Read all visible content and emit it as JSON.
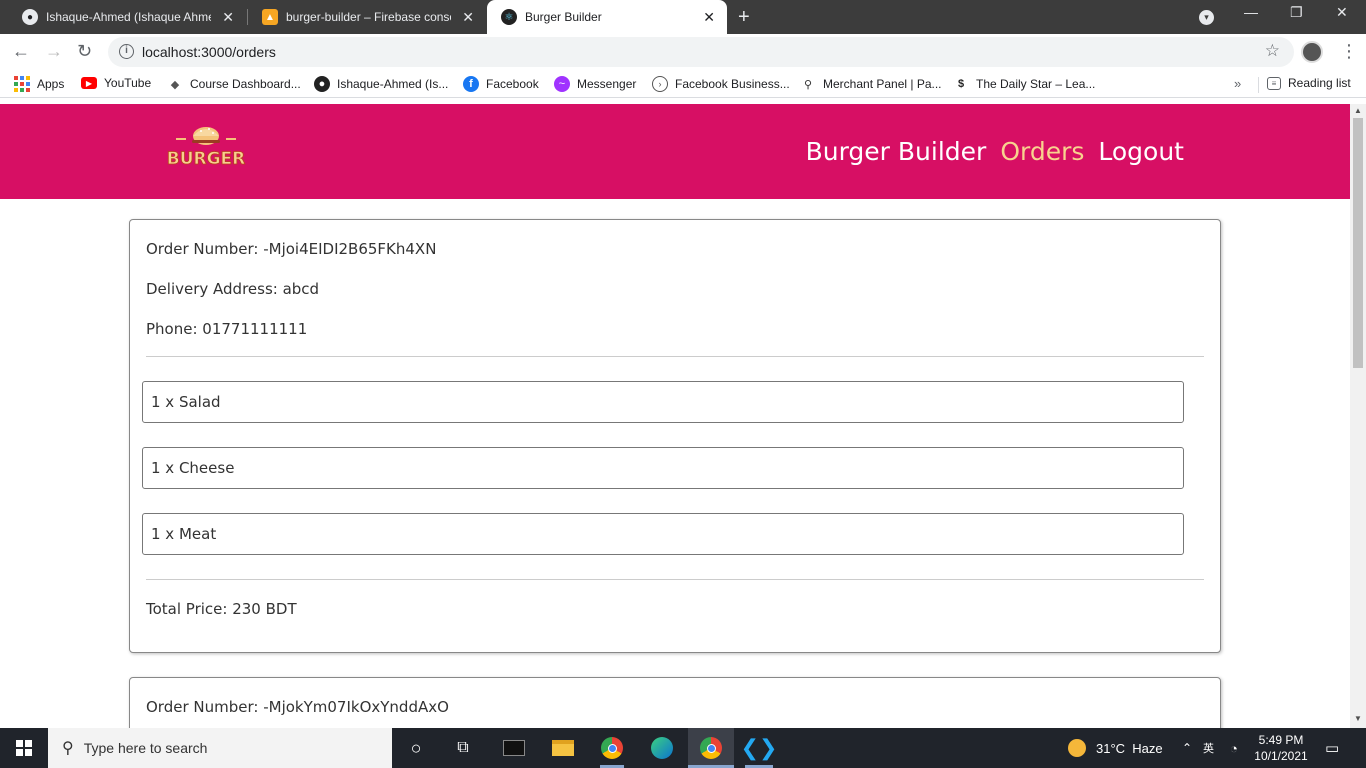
{
  "browser": {
    "tabs": [
      {
        "title": "Ishaque-Ahmed (Ishaque Ahmed)",
        "favicon": "github-icon",
        "active": false
      },
      {
        "title": "burger-builder – Firebase console",
        "favicon": "firebase-icon",
        "active": false
      },
      {
        "title": "Burger Builder",
        "favicon": "react-icon",
        "active": true
      }
    ],
    "url": "localhost:3000/orders",
    "bookmarks": [
      {
        "label": "Apps",
        "icon": "apps-grid-icon"
      },
      {
        "label": "YouTube",
        "icon": "youtube-icon"
      },
      {
        "label": "Course Dashboard...",
        "icon": "course-icon"
      },
      {
        "label": "Ishaque-Ahmed (Is...",
        "icon": "github-icon"
      },
      {
        "label": "Facebook",
        "icon": "facebook-icon"
      },
      {
        "label": "Messenger",
        "icon": "messenger-icon"
      },
      {
        "label": "Facebook Business...",
        "icon": "facebook-business-icon"
      },
      {
        "label": "Merchant Panel | Pa...",
        "icon": "bicycle-icon"
      },
      {
        "label": "The Daily Star – Lea...",
        "icon": "daily-star-icon"
      }
    ],
    "bookmarks_more": "»",
    "reading_list": "Reading list"
  },
  "app": {
    "logo_text": "BURGER",
    "nav": [
      {
        "label": "Burger Builder",
        "active": false
      },
      {
        "label": "Orders",
        "active": true
      },
      {
        "label": "Logout",
        "active": false
      }
    ]
  },
  "orders": [
    {
      "order_number": "Order Number: -Mjoi4EIDI2B65FKh4XN",
      "address": "Delivery Address: abcd",
      "phone": "Phone: 01771111111",
      "ingredients": [
        "1 x Salad",
        "1 x Cheese",
        "1 x Meat"
      ],
      "total": "Total Price: 230 BDT"
    },
    {
      "order_number": "Order Number: -MjokYm07IkOxYnddAxO"
    }
  ],
  "taskbar": {
    "search_placeholder": "Type here to search",
    "weather": "31°C  Haze",
    "time": "5:49 PM",
    "date": "10/1/2021",
    "ime": "英"
  },
  "colors": {
    "navbar": "#d70f64",
    "nav_active": "#f8d28e"
  }
}
